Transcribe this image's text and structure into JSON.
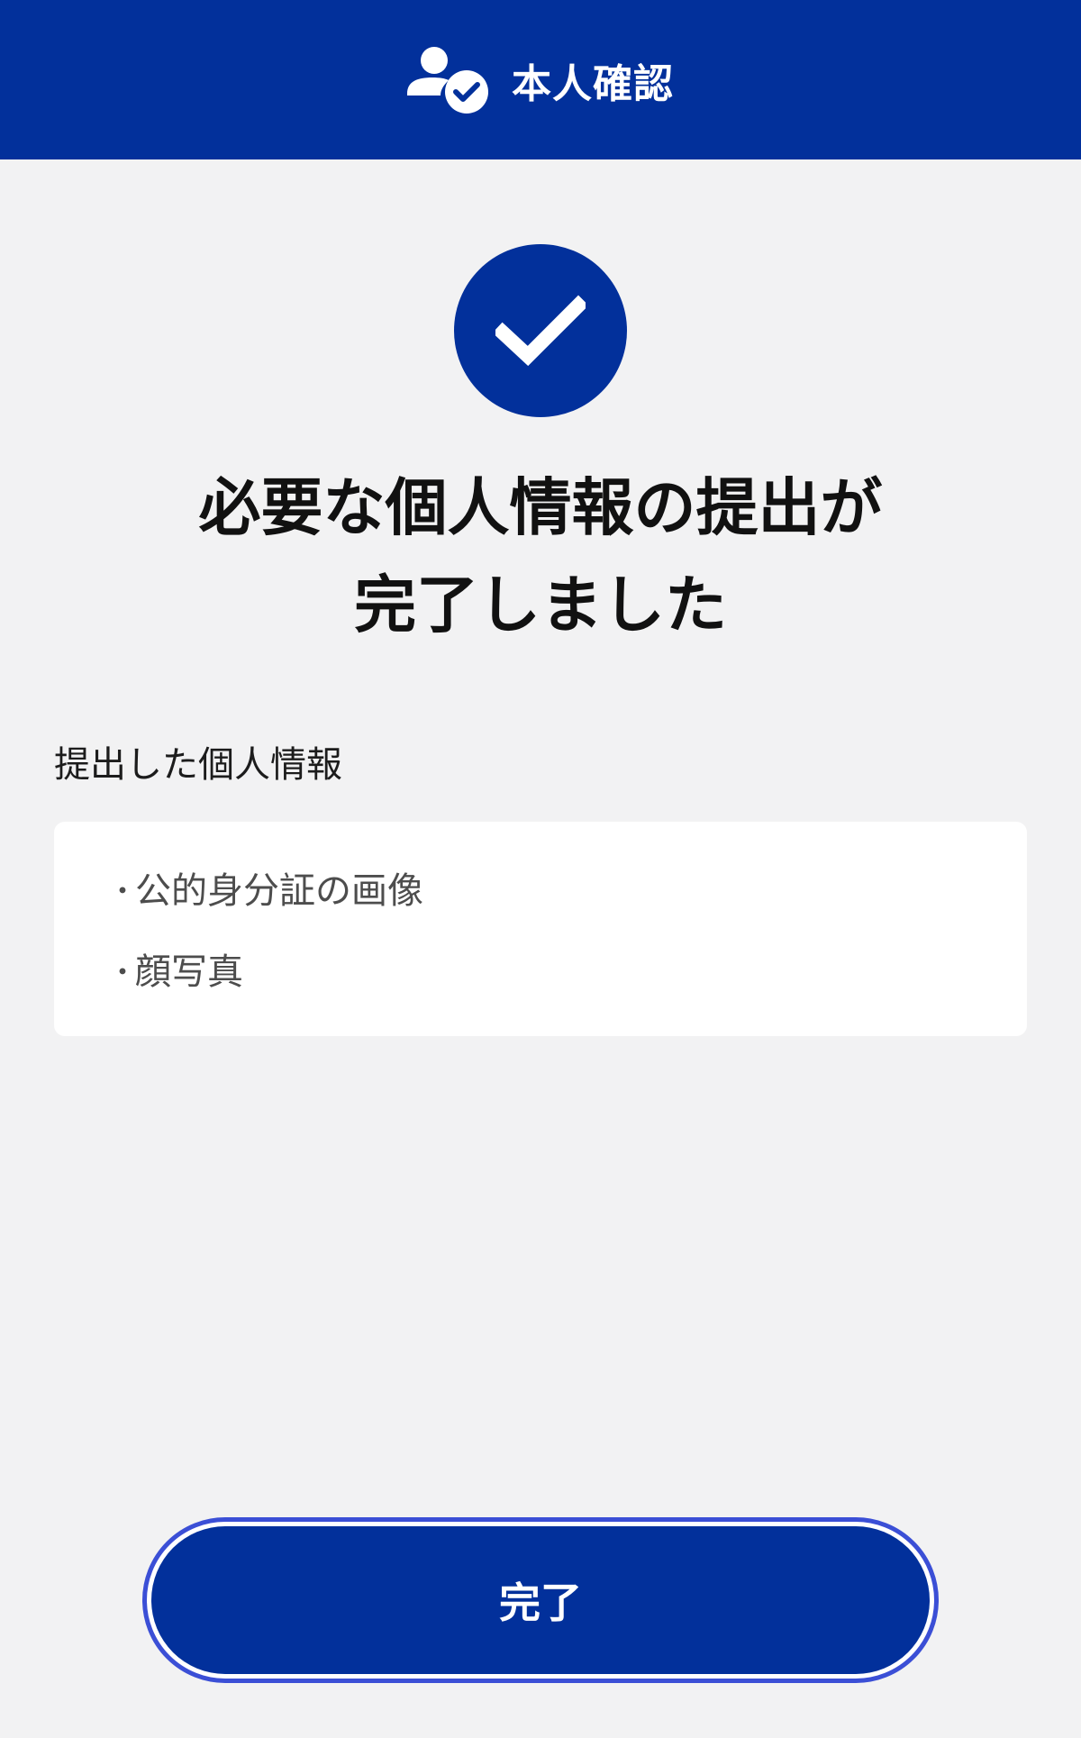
{
  "header": {
    "title": "本人確認",
    "icon": "person-check-icon"
  },
  "status": {
    "icon": "check-icon",
    "headline_line1": "必要な個人情報の提出が",
    "headline_line2": "完了しました"
  },
  "submitted": {
    "label": "提出した個人情報",
    "bullet": "・",
    "items": [
      "公的身分証の画像",
      "顔写真"
    ]
  },
  "actions": {
    "done_label": "完了"
  },
  "colors": {
    "brand": "#02309b",
    "background": "#f2f2f3",
    "focus_ring": "#3b4fd6"
  }
}
